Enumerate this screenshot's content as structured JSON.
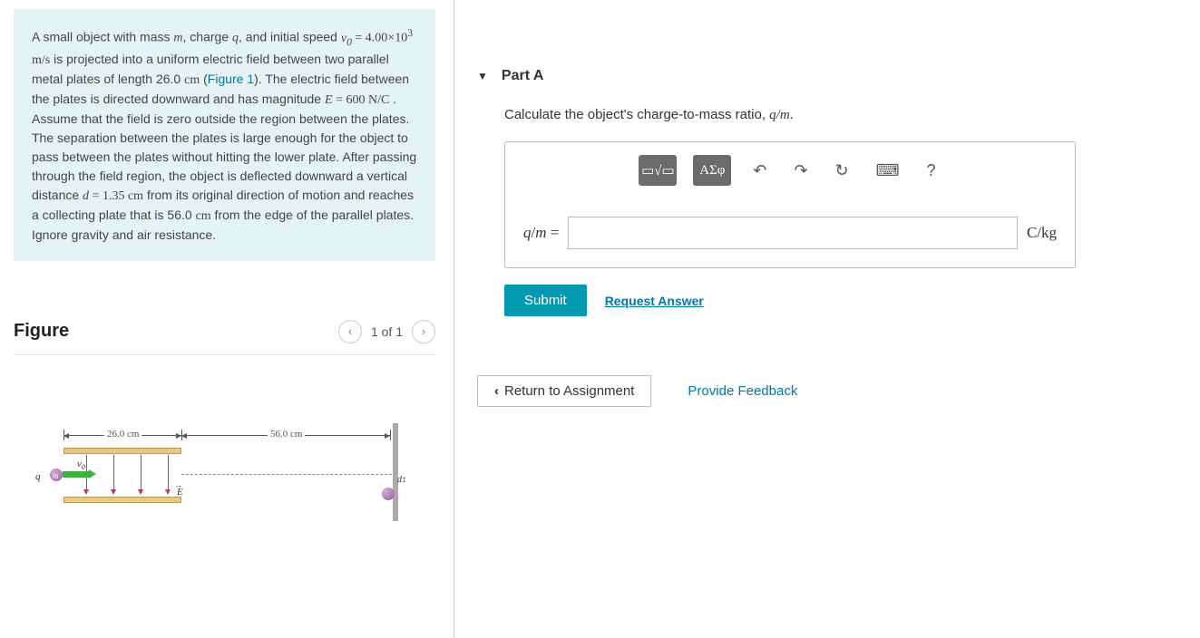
{
  "problem": {
    "text_pre": "A small object with mass ",
    "m": "m",
    "text_2": ", charge ",
    "q": "q",
    "text_3": ", and initial speed ",
    "v0_sym": "v",
    "v0_sub": "0",
    "v0_eq": " = 4.00×10",
    "v0_exp": "3",
    "v0_unit": "  m/s",
    "text_4": " is projected into a uniform electric field between two parallel metal plates of length 26.0 ",
    "cm1": "cm",
    "text_5": " (",
    "fig_link": "Figure 1",
    "text_6": "). The electric field between the plates is directed downward and has magnitude ",
    "E_sym": "E",
    "E_eq": " = 600  ",
    "E_unit": "N/C",
    "text_7": " . Assume that the field is zero outside the region between the plates. The separation between the plates is large enough for the object to pass between the plates without hitting the lower plate. After passing through the field region, the object is deflected downward a vertical distance ",
    "d_sym": "d",
    "d_eq": " = 1.35  ",
    "d_unit": "cm",
    "text_8": " from its original direction of motion and reaches a collecting plate that is 56.0 ",
    "cm2": "cm",
    "text_9": " from the edge of the parallel plates. Ignore gravity and air resistance."
  },
  "figure": {
    "title": "Figure",
    "page": "1 of 1",
    "dim1": "26.0 cm",
    "dim2": "56.0 cm",
    "v0_label": "v",
    "v0_sub": "0",
    "q_label": "q",
    "m_label": "m",
    "E_label": "E",
    "d_label": "d"
  },
  "partA": {
    "title": "Part A",
    "instruction_pre": "Calculate the object's charge-to-mass ratio, ",
    "ratio": "q/m",
    "period": ".",
    "toolbar": {
      "templates": "▭√▭",
      "greek": "ΑΣφ",
      "undo": "↶",
      "redo": "↷",
      "reset": "↻",
      "keyboard": "⌨",
      "help": "?"
    },
    "lhs_q": "q",
    "lhs_slash": "/",
    "lhs_m": "m",
    "lhs_eq": " =",
    "unit": "C/kg",
    "submit": "Submit",
    "request": "Request Answer"
  },
  "bottom": {
    "return": "Return to Assignment",
    "feedback": "Provide Feedback"
  }
}
